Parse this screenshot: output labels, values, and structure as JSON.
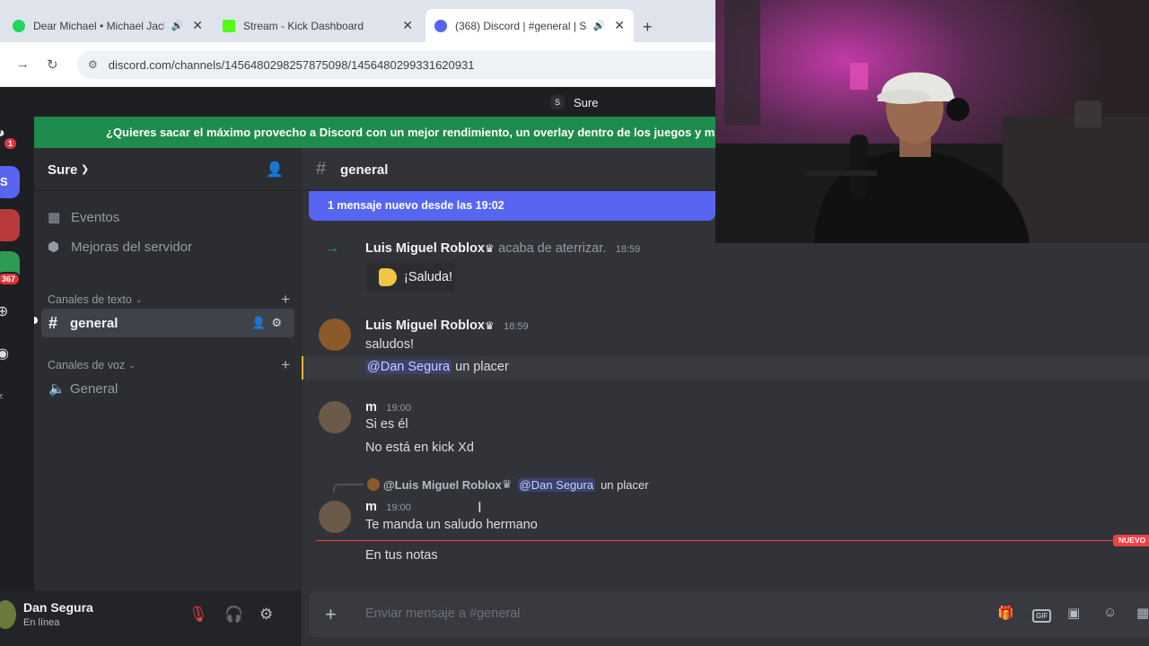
{
  "browser": {
    "tabs": [
      {
        "title": "Dear Michael • Michael Jack",
        "favicon_color": "#1ed760",
        "audio": true,
        "active": false
      },
      {
        "title": "Stream - Kick Dashboard",
        "favicon_color": "#53fc18",
        "audio": false,
        "active": false
      },
      {
        "title": "(368) Discord | #general | S",
        "favicon_color": "#5865f2",
        "audio": true,
        "active": true
      }
    ],
    "url": "discord.com/channels/1456480298257875098/1456480299331620931"
  },
  "title_bar": {
    "server_initial": "S",
    "server_name": "Sure"
  },
  "banner": {
    "text": "¿Quieres sacar el máximo provecho a Discord con un mejor rendimiento, un overlay dentro de los juegos y mucho m"
  },
  "rail": {
    "badge_top": "1",
    "badge_count": "367",
    "server_initial": "S"
  },
  "sidebar": {
    "server_name": "Sure",
    "items": [
      {
        "label": "Eventos",
        "icon": "calendar-icon"
      },
      {
        "label": "Mejoras del servidor",
        "icon": "boost-icon"
      }
    ],
    "text_category": "Canales de texto",
    "text_channel": "general",
    "voice_category": "Canales de voz",
    "voice_channel": "General"
  },
  "user": {
    "name": "Dan Segura",
    "status": "En línea"
  },
  "chat": {
    "channel": "general",
    "new_banner": "1 mensaje nuevo desde las 19:02",
    "system": {
      "author": "Luis Miguel  Roblox",
      "text": "acaba de aterrizar.",
      "time": "18:59",
      "greet": "¡Saluda!"
    },
    "msg1": {
      "author": "Luis Miguel  Roblox",
      "time": "18:59",
      "line1": "saludos!",
      "mention": "@Dan Segura",
      "line2": "un placer"
    },
    "msg2": {
      "author": "m",
      "time": "19:00",
      "line1": "Si es él",
      "line2": "No está en kick Xd"
    },
    "reply": {
      "author": "@Luis Miguel  Roblox",
      "mention": "@Dan Segura",
      "text": "un placer"
    },
    "msg3": {
      "author": "m",
      "time": "19:00",
      "line1": "Te manda un saludo hermano"
    },
    "new_label": "NUEVO",
    "msg4": {
      "line1": "En tus notas"
    },
    "placeholder": "Enviar mensaje a #general",
    "gif_label": "GIF"
  },
  "colors": {
    "blurple": "#5865f2",
    "green_banner": "#1f8b4c",
    "red": "#f23f43"
  }
}
